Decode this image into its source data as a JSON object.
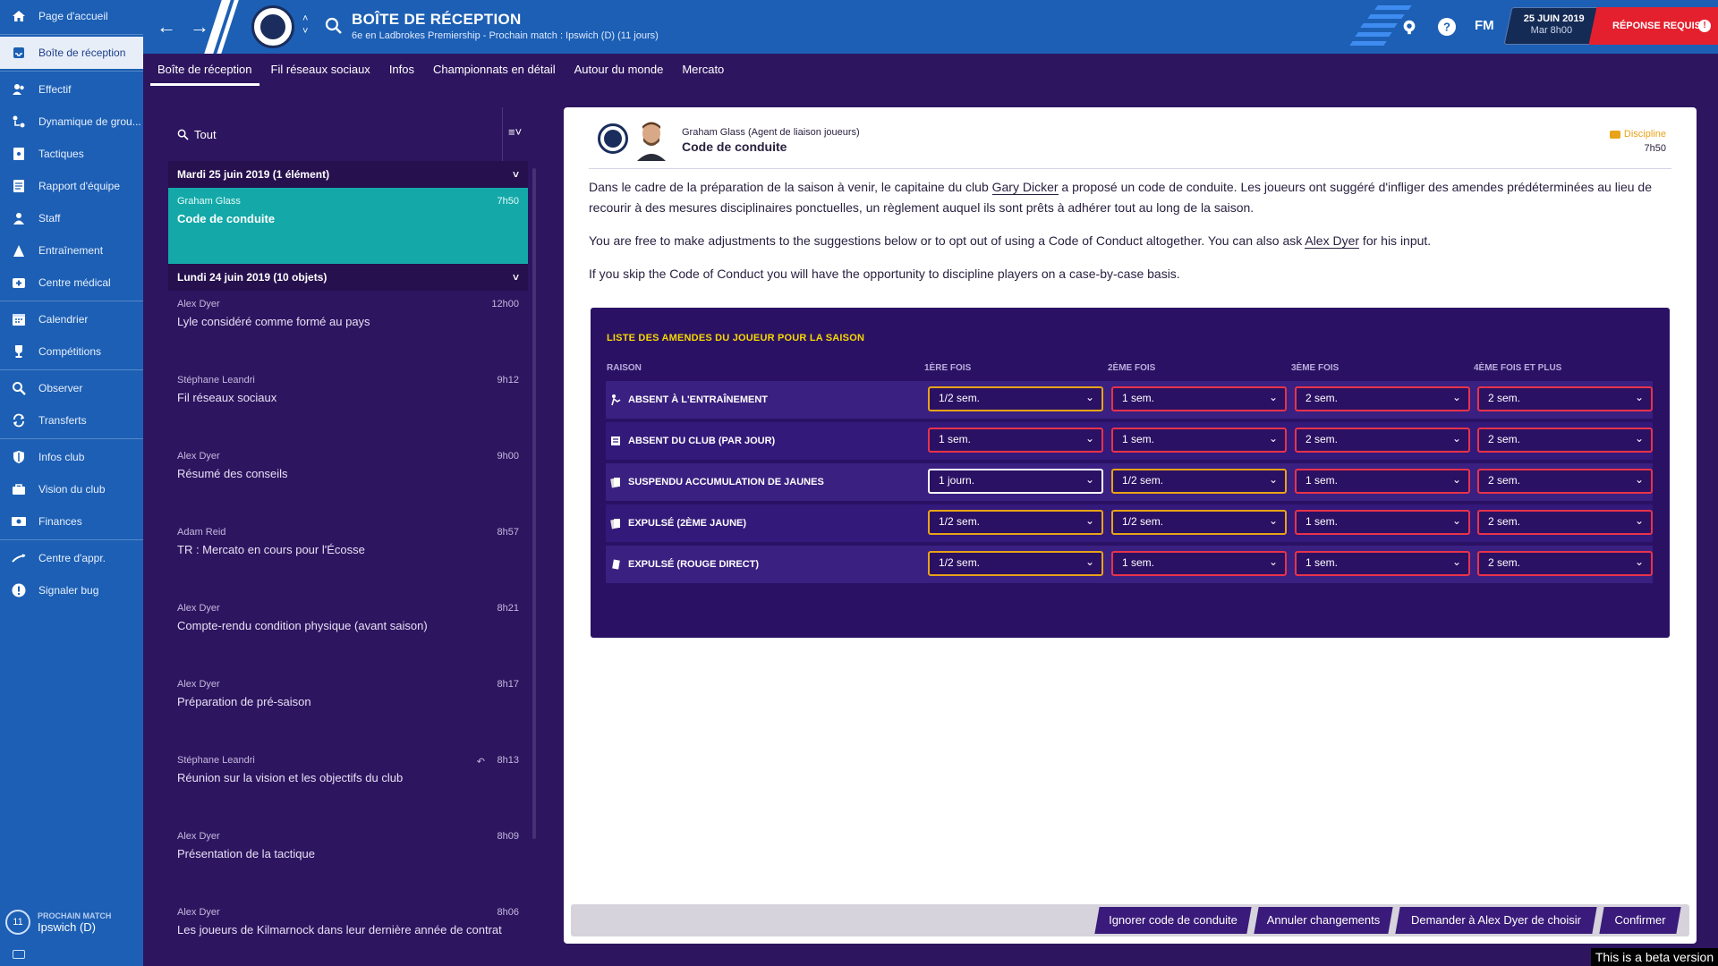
{
  "sidebar": {
    "items": [
      {
        "label": "Page d'accueil",
        "icon": "home-icon"
      },
      {
        "label": "Boîte de réception",
        "icon": "inbox-icon"
      },
      {
        "label": "Effectif",
        "icon": "squad-icon"
      },
      {
        "label": "Dynamique de grou...",
        "icon": "dynamics-icon"
      },
      {
        "label": "Tactiques",
        "icon": "tactics-icon"
      },
      {
        "label": "Rapport d'équipe",
        "icon": "report-icon"
      },
      {
        "label": "Staff",
        "icon": "staff-icon"
      },
      {
        "label": "Entraînement",
        "icon": "training-icon"
      },
      {
        "label": "Centre médical",
        "icon": "medical-icon"
      },
      {
        "label": "Calendrier",
        "icon": "calendar-icon"
      },
      {
        "label": "Compétitions",
        "icon": "trophy-icon"
      },
      {
        "label": "Observer",
        "icon": "scout-icon"
      },
      {
        "label": "Transferts",
        "icon": "transfer-icon"
      },
      {
        "label": "Infos club",
        "icon": "shield-icon"
      },
      {
        "label": "Vision du club",
        "icon": "vision-icon"
      },
      {
        "label": "Finances",
        "icon": "finances-icon"
      },
      {
        "label": "Centre d'appr.",
        "icon": "academy-icon"
      },
      {
        "label": "Signaler bug",
        "icon": "bug-report-icon"
      }
    ],
    "next_match_label": "PROCHAIN MATCH",
    "next_match_value": "Ipswich (D)",
    "next_match_days": "11"
  },
  "topbar": {
    "title": "BOÎTE DE RÉCEPTION",
    "subtitle": "6e en Ladbrokes Premiership - Prochain match : Ipswich (D) (11 jours)",
    "fm_logo": "FM",
    "date_line1": "25 JUIN 2019",
    "date_line2": "Mar 8h00",
    "reply_required": "RÉPONSE REQUISE",
    "reply_mark": "!",
    "help_mark": "?"
  },
  "tabs": [
    {
      "label": "Boîte de réception",
      "active": true
    },
    {
      "label": "Fil réseaux sociaux",
      "active": false
    },
    {
      "label": "Infos",
      "active": false
    },
    {
      "label": "Championnats en détail",
      "active": false
    },
    {
      "label": "Autour du monde",
      "active": false
    },
    {
      "label": "Mercato",
      "active": false
    }
  ],
  "inbox": {
    "filter_label": "Tout",
    "group1": {
      "header": "Mardi 25 juin 2019 (1 élément)",
      "messages": [
        {
          "sender": "Graham Glass",
          "time": "7h50",
          "subject": "Code de conduite"
        }
      ]
    },
    "group2": {
      "header": "Lundi 24 juin 2019 (10 objets)",
      "messages": [
        {
          "sender": "Alex Dyer",
          "time": "12h00",
          "subject": "Lyle considéré comme formé au pays"
        },
        {
          "sender": "Stéphane Leandri",
          "time": "9h12",
          "subject": "Fil réseaux sociaux"
        },
        {
          "sender": "Alex Dyer",
          "time": "9h00",
          "subject": "Résumé des conseils"
        },
        {
          "sender": "Adam Reid",
          "time": "8h57",
          "subject": "TR : Mercato en cours pour l'Écosse"
        },
        {
          "sender": "Alex Dyer",
          "time": "8h21",
          "subject": "Compte-rendu condition physique (avant saison)"
        },
        {
          "sender": "Alex Dyer",
          "time": "8h17",
          "subject": "Préparation de pré-saison"
        },
        {
          "sender": "Stéphane Leandri",
          "time": "8h13",
          "subject": "Réunion sur la vision et les objectifs du club"
        },
        {
          "sender": "Alex Dyer",
          "time": "8h09",
          "subject": "Présentation de la tactique"
        },
        {
          "sender": "Alex Dyer",
          "time": "8h06",
          "subject": "Les joueurs de Kilmarnock dans leur dernière année de contrat"
        }
      ]
    }
  },
  "message": {
    "from": "Graham Glass  (Agent de liaison joueurs)",
    "title": "Code de conduite",
    "tag": "Discipline",
    "time": "7h50",
    "p1_a": "Dans le cadre de la préparation de la saison à venir, le capitaine du club ",
    "p1_name": "Gary Dicker",
    "p1_b": " a proposé un code de conduite. Les joueurs ont suggéré d'infliger des amendes prédéterminées au lieu de recourir à des mesures disciplinaires ponctuelles, un règlement auquel ils sont prêts à adhérer tout au long de la saison.",
    "p2_a": "You are free to make adjustments to the suggestions below or to opt out of using a Code of Conduct altogether. You can also ask ",
    "p2_name": "Alex Dyer",
    "p2_b": " for his input.",
    "p3": "If you skip the Code of Conduct you will have the opportunity to discipline players on a case-by-case basis."
  },
  "fines": {
    "title": "LISTE DES AMENDES DU JOUEUR POUR LA SAISON",
    "headers": [
      "RAISON",
      "1ÈRE FOIS",
      "2ÈME FOIS",
      "3ÈME FOIS",
      "4ÈME FOIS ET PLUS"
    ],
    "rows": [
      {
        "reason": "ABSENT À L'ENTRAÎNEMENT",
        "icon": "absent-training-icon",
        "values": [
          "1/2 sem.",
          "1 sem.",
          "2 sem.",
          "2 sem."
        ]
      },
      {
        "reason": "ABSENT DU CLUB (PAR JOUR)",
        "icon": "absent-club-icon",
        "values": [
          "1 sem.",
          "1 sem.",
          "2 sem.",
          "2 sem."
        ]
      },
      {
        "reason": "SUSPENDU ACCUMULATION DE JAUNES",
        "icon": "yellow-cards-icon",
        "values": [
          "1 journ.",
          "1/2 sem.",
          "1 sem.",
          "2 sem."
        ]
      },
      {
        "reason": "EXPULSÉ (2ÈME JAUNE)",
        "icon": "second-yellow-icon",
        "values": [
          "1/2 sem.",
          "1/2 sem.",
          "1 sem.",
          "2 sem."
        ]
      },
      {
        "reason": "EXPULSÉ (ROUGE DIRECT)",
        "icon": "red-card-icon",
        "values": [
          "1/2 sem.",
          "1 sem.",
          "1 sem.",
          "2 sem."
        ]
      }
    ]
  },
  "actions": {
    "ignore": "Ignorer code de conduite",
    "cancel": "Annuler changements",
    "ask": "Demander à Alex Dyer de choisir",
    "confirm": "Confirmer"
  },
  "beta_text": "This is a beta version",
  "colors": {
    "sidebar": "#1c5fb4",
    "background": "#2e1560",
    "selected_message": "#14a9a8",
    "reply_required": "#e4202e",
    "fines_title": "#f5d800",
    "select_border": "#e8a317"
  }
}
